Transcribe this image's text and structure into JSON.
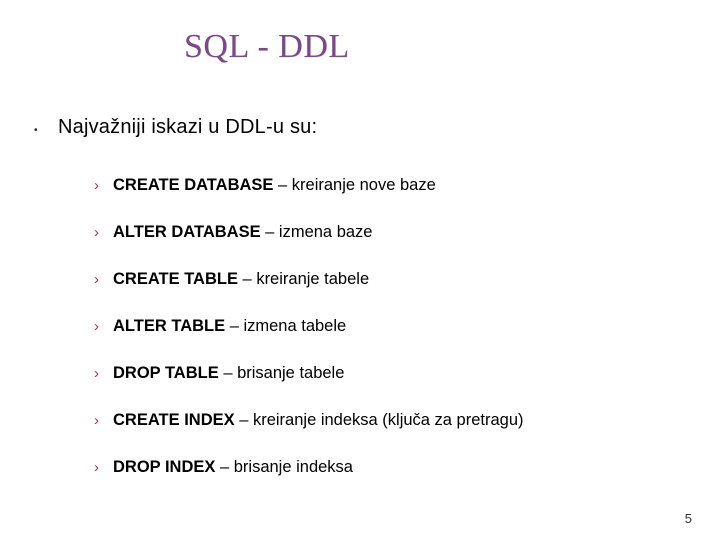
{
  "title": "SQL -    DDL",
  "main_text": "Najvažniji iskazi u  DDL-u su:",
  "items": [
    {
      "cmd": "CREATE DATABASE",
      "desc": " – kreiranje nove baze"
    },
    {
      "cmd": "ALTER DATABASE",
      "desc": " – izmena baze"
    },
    {
      "cmd": "CREATE TABLE",
      "desc": " – kreiranje tabele"
    },
    {
      "cmd": "ALTER TABLE",
      "desc": " – izmena tabele"
    },
    {
      "cmd": "DROP TABLE",
      "desc": " – brisanje tabele"
    },
    {
      "cmd": "CREATE INDEX",
      "desc": " – kreiranje indeksa (ključa za pretragu)"
    },
    {
      "cmd": "DROP INDEX",
      "desc": " – brisanje indeksa"
    }
  ],
  "page_number": "5",
  "bullet_chev": "›"
}
